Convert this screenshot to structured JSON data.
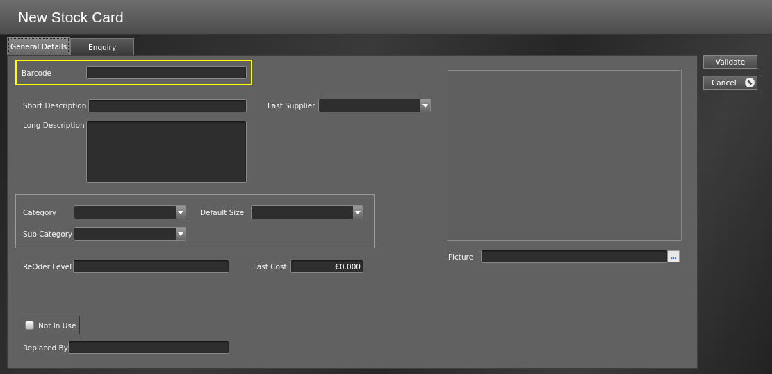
{
  "window": {
    "title": "New Stock Card"
  },
  "tabs": [
    {
      "label": "General Details",
      "selected": true
    },
    {
      "label": "Enquiry",
      "selected": false
    }
  ],
  "barcode": {
    "label": "Barcode",
    "highlighted": true
  },
  "short_description": {
    "label": "Short Description"
  },
  "last_supplier": {
    "label": "Last Supplier"
  },
  "long_description": {
    "label": "Long Description"
  },
  "category": {
    "label": "Category"
  },
  "default_size": {
    "label": "Default Size"
  },
  "sub_category": {
    "label": "Sub Category"
  },
  "reorder_level": {
    "label": "ReOder Level"
  },
  "last_cost": {
    "label": "Last Cost",
    "value": "€0.000"
  },
  "picture": {
    "label": "Picture",
    "browse": "..."
  },
  "not_in_use": {
    "label": "Not In Use",
    "checked": false
  },
  "replaced_by": {
    "label": "Replaced By"
  },
  "buttons": [
    {
      "label": "Validate",
      "kind": "plain"
    },
    {
      "label": "Cancel",
      "kind": "cancel"
    }
  ]
}
